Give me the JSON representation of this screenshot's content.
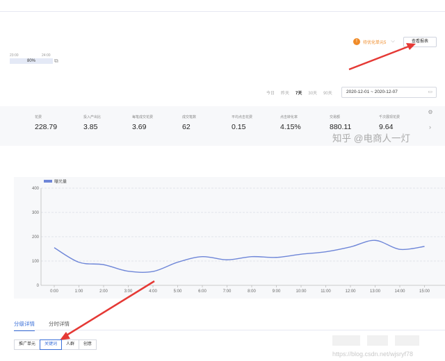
{
  "schedule": {
    "time_start": "23:00",
    "time_end": "24:00",
    "percent": "80%",
    "edit_icon": "external-link-icon"
  },
  "header": {
    "pending_label": "待优化单元5",
    "pending_icon": "!",
    "report_button": "查看报表"
  },
  "range": {
    "options": [
      "今日",
      "昨天",
      "7天",
      "30天",
      "90天"
    ],
    "active": "7天",
    "date_range": "2020-12-01 ~ 2020-12-07"
  },
  "metrics": [
    {
      "label": "花费",
      "value": "228.79"
    },
    {
      "label": "投入产出比",
      "value": "3.85"
    },
    {
      "label": "每笔成交花费",
      "value": "3.69"
    },
    {
      "label": "成交笔数",
      "value": "62"
    },
    {
      "label": "平均点击花费",
      "value": "0.15"
    },
    {
      "label": "点击转化率",
      "value": "4.15%"
    },
    {
      "label": "交易额",
      "value": "880.11"
    },
    {
      "label": "千次展现花费",
      "value": "9.64"
    }
  ],
  "watermark": "知乎 @电商人一灯",
  "watermark2": "https://blog.csdn.net/wjsryf78",
  "chart_data": {
    "type": "line",
    "title": "",
    "legend": [
      "曝光量"
    ],
    "xlabel": "",
    "ylabel": "",
    "ylim": [
      0,
      400
    ],
    "yticks": [
      0,
      100,
      200,
      300,
      400
    ],
    "x": [
      "0:00",
      "1:00",
      "2:00",
      "3:00",
      "4:00",
      "5:00",
      "6:00",
      "7:00",
      "8:00",
      "9:00",
      "10:00",
      "11:00",
      "12:00",
      "13:00",
      "14:00",
      "15:00"
    ],
    "series": [
      {
        "name": "曝光量",
        "color": "#6e86d8",
        "values": [
          155,
          95,
          85,
          58,
          57,
          95,
          118,
          105,
          118,
          115,
          128,
          138,
          158,
          185,
          148,
          160
        ]
      }
    ],
    "grid": true,
    "legend_position": "top-left"
  },
  "detail_tabs": {
    "items": [
      "分级详情",
      "分时详情"
    ],
    "active": "分级详情"
  },
  "sub_tabs": {
    "items": [
      "推广单元",
      "关键词",
      "人群",
      "创意"
    ],
    "active": "关键词"
  },
  "colors": {
    "accent": "#3a6fd8",
    "warning": "#f08b28",
    "annotation_arrow": "#e53935",
    "line": "#6e86d8"
  }
}
